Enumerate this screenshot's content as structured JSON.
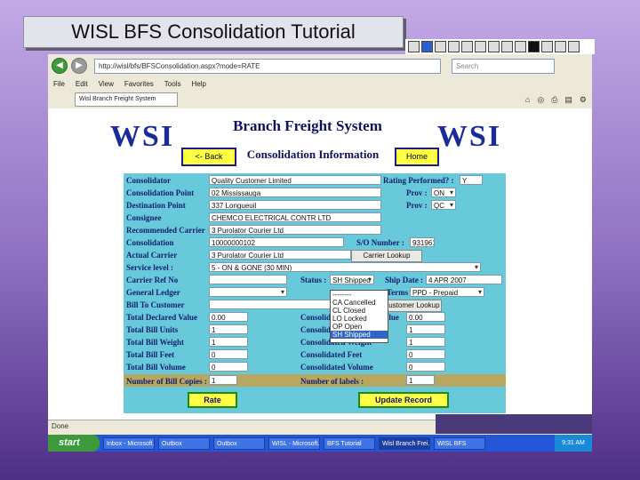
{
  "slide_title": "WISL BFS Consolidation Tutorial",
  "browser": {
    "address": "http://wisl/bfs/BFSConsolidation.aspx?mode=RATE",
    "search_placeholder": "Search",
    "menus": [
      "File",
      "Edit",
      "View",
      "Favorites",
      "Tools",
      "Help"
    ],
    "tab_label": "Wisl Branch Freight System"
  },
  "page": {
    "logo_left": "WSI",
    "logo_right": "WSI",
    "app_title": "Branch Freight System",
    "subtitle": "Consolidation Information",
    "back_label": "<- Back",
    "home_label": "Home"
  },
  "labels": {
    "consolidator": "Consolidator",
    "consolidation_point": "Consolidation Point",
    "destination_point": "Destination Point",
    "consignee": "Consignee",
    "recommended_carrier": "Recommended Carrier",
    "consolidation": "Consolidation",
    "actual_carrier": "Actual Carrier",
    "service_level": "Service level :",
    "carrier_ref_no": "Carrier Ref No",
    "general_ledger": "General Ledger",
    "bill_to_customer": "Bill To Customer",
    "total_declared_value": "Total Declared Value",
    "total_bill_units": "Total Bill Units",
    "total_bill_weight": "Total Bill Weight",
    "total_bill_feet": "Total Bill Feet",
    "total_bill_volume": "Total Bill Volume",
    "number_of_bill_copies": "Number of Bill Copies :",
    "rating_performed": "Rating Performed? :",
    "prov_from": "Prov :",
    "prov_to": "Prov :",
    "so_number": "S/O Number :",
    "status": "Status :",
    "ship_date": "Ship Date :",
    "terms": "Terms :",
    "consolidated_declared_value": "Consolidated Declared Value",
    "consolidated_units": "Consolidated Units",
    "consolidated_weight": "Consolidated Weight",
    "consolidated_feet": "Consolidated Feet",
    "consolidated_volume": "Consolidated Volume",
    "number_of_labels": "Number of labels :"
  },
  "values": {
    "consolidator": "Quality Customer Limited",
    "consolidation_point": "02 Mississauga",
    "destination_point": "337 Longueuil",
    "consignee": "CHEMCO ELECTRICAL CONTR LTD",
    "recommended_carrier": "3 Purolator Courier Ltd",
    "consolidation": "10000000102",
    "actual_carrier": "3 Purolator Courier Ltd",
    "service_level": "5 - ON & GONE (30 MIN)",
    "carrier_ref_no": "",
    "general_ledger": "",
    "bill_to_customer": "",
    "total_declared_value": "0.00",
    "total_bill_units": "1",
    "total_bill_weight": "1",
    "total_bill_feet": "0",
    "total_bill_volume": "0",
    "number_of_bill_copies": "1",
    "rating_performed": "Y",
    "prov_from": "ON",
    "prov_to": "QC",
    "so_number": "931961",
    "status": "SH Shipped",
    "ship_date": "4 APR 2007",
    "terms": "PPD - Prepaid",
    "consolidated_declared_value": "0.00",
    "consolidated_units": "1",
    "consolidated_weight": "1",
    "consolidated_feet": "0",
    "consolidated_volume": "0",
    "number_of_labels": "1"
  },
  "buttons": {
    "carrier_lookup": "Carrier Lookup",
    "customer_lookup": "Customer Lookup",
    "rate": "Rate",
    "update_record": "Update Record"
  },
  "status_options": [
    "--------",
    "CA Cancelled",
    "CL Closed",
    "LO Locked",
    "OP Open",
    "SH Shipped"
  ],
  "status_bar": "Done",
  "taskbar": {
    "start": "start",
    "tasks": [
      "Inbox - Microsoft...",
      "Outbox",
      "Outbox",
      "WISL - Microsoft...",
      "BFS Tutorial",
      "Wisl Branch Frei...",
      "WISL BFS"
    ],
    "clock": "9:31 AM"
  }
}
